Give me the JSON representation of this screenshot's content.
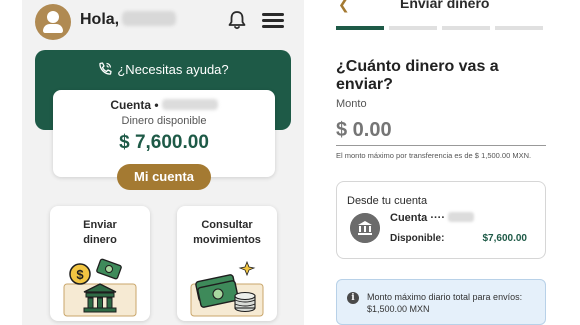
{
  "home": {
    "greeting": "Hola,",
    "help_text": "¿Necesitas ayuda?",
    "account_label": "Cuenta •",
    "available_label": "Dinero disponible",
    "balance": "$ 7,600.00",
    "my_account_button": "Mi cuenta",
    "tiles": [
      {
        "label": "Enviar\ndinero",
        "icon": "send-money-illustration"
      },
      {
        "label": "Consultar\nmovimientos",
        "icon": "money-stack-illustration"
      }
    ],
    "icons": {
      "avatar": "user-avatar",
      "notifications": "bell-icon",
      "menu": "hamburger-icon",
      "help": "phone-call-icon"
    }
  },
  "send": {
    "title": "Enviar dinero",
    "progress_steps": 4,
    "progress_current": 1,
    "question": "¿Cuánto dinero vas a enviar?",
    "amount_label": "Monto",
    "amount_placeholder": "$ 0.00",
    "max_note": "El monto máximo por transferencia es de $ 1,500.00 MXN.",
    "source": {
      "title": "Desde tu cuenta",
      "account_label": "Cuenta ····",
      "available_label": "Disponible:",
      "available_value": "$7,600.00"
    },
    "info": "Monto máximo diario total para envíos: $1,500.00 MXN"
  },
  "colors": {
    "primary_green": "#1e5a47",
    "accent_gold": "#a47a32",
    "info_blue_bg": "#e5f0fa"
  }
}
